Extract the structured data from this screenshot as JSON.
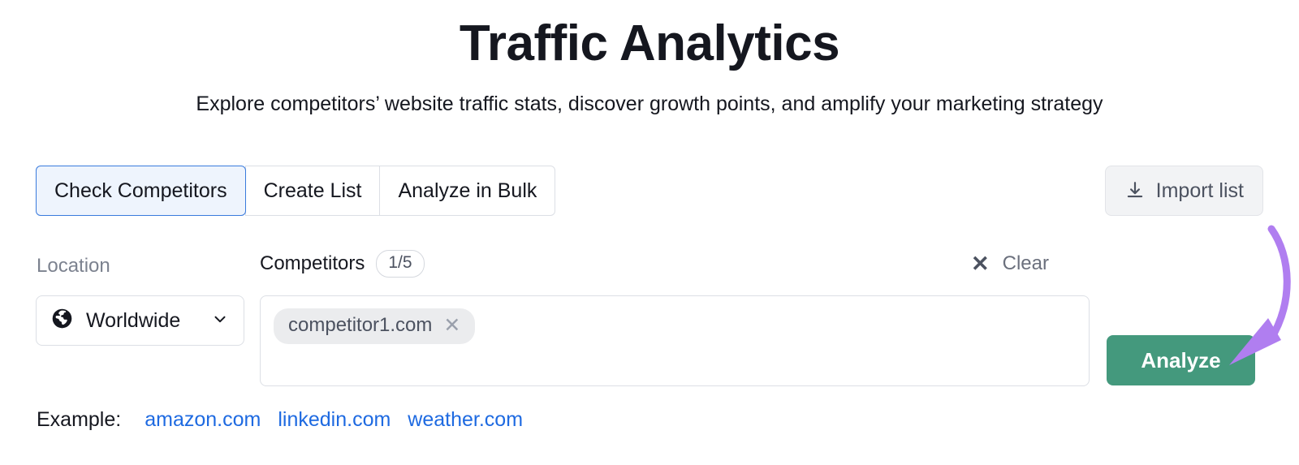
{
  "header": {
    "title": "Traffic Analytics",
    "subtitle": "Explore competitors’ website traffic stats, discover growth points, and amplify your marketing strategy"
  },
  "tabs": [
    {
      "label": "Check Competitors",
      "active": true
    },
    {
      "label": "Create List",
      "active": false
    },
    {
      "label": "Analyze in Bulk",
      "active": false
    }
  ],
  "toolbar": {
    "import_list_label": "Import list",
    "import_icon": "download-icon"
  },
  "form": {
    "location_label": "Location",
    "competitors_label": "Competitors",
    "competitors_count": "1/5",
    "clear_label": "Clear",
    "clear_icon": "close-icon",
    "location_value": "Worldwide",
    "location_icon": "globe-icon",
    "location_chevron": "chevron-down-icon",
    "competitor_chips": [
      {
        "label": "competitor1.com",
        "remove_icon": "close-icon",
        "remove_glyph": "✕"
      }
    ],
    "analyze_label": "Analyze"
  },
  "examples": {
    "label": "Example:",
    "links": [
      "amazon.com",
      "linkedin.com",
      "weather.com"
    ]
  },
  "annotation": {
    "type": "curved-arrow",
    "color": "#b07ef0",
    "points_to": "analyze-button"
  },
  "colors": {
    "accent_green": "#44997d",
    "tab_active_bg": "#eef4fd",
    "tab_active_border": "#3a7bdd",
    "link_blue": "#1e6ae1",
    "arrow_purple": "#b07ef0",
    "text_dark": "#15171f",
    "text_muted": "#7c828f"
  }
}
